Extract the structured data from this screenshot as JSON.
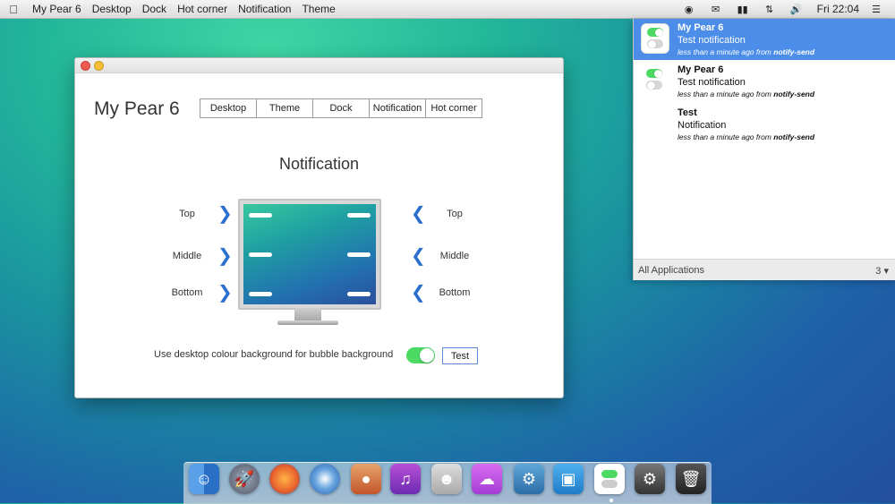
{
  "menubar": {
    "app_name": "My Pear 6",
    "items": [
      "Desktop",
      "Dock",
      "Hot corner",
      "Notification",
      "Theme"
    ],
    "tray_icons": [
      "spotlight-icon",
      "mail-icon",
      "battery-icon",
      "network-icon",
      "volume-icon"
    ],
    "clock": "Fri 22:04"
  },
  "window": {
    "app_title": "My Pear 6",
    "tabs": [
      "Desktop",
      "Theme",
      "Dock",
      "Notification",
      "Hot corner"
    ],
    "section_title": "Notification",
    "left_labels": [
      "Top",
      "Middle",
      "Bottom"
    ],
    "right_labels": [
      "Top",
      "Middle",
      "Bottom"
    ],
    "option_label": "Use desktop colour background for bubble background",
    "toggle_on": true,
    "test_button": "Test"
  },
  "notifications": {
    "items": [
      {
        "title": "My Pear 6",
        "body": "Test notification",
        "meta_prefix": "less than a minute ago from ",
        "source": "notify-send",
        "selected": true,
        "has_icon": true
      },
      {
        "title": "My Pear 6",
        "body": "Test notification",
        "meta_prefix": "less than a minute ago from ",
        "source": "notify-send",
        "selected": false,
        "has_icon": true
      },
      {
        "title": "Test",
        "body": "Notification",
        "meta_prefix": "less than a minute ago from ",
        "source": "notify-send",
        "selected": false,
        "has_icon": false
      }
    ],
    "footer_label": "All Applications",
    "footer_count": "3"
  },
  "dock": {
    "apps": [
      "finder",
      "launchpad",
      "firefox",
      "thunderbird",
      "photos",
      "itunes",
      "contacts",
      "icloud",
      "settings",
      "display",
      "notification",
      "terminal",
      "trash"
    ]
  }
}
